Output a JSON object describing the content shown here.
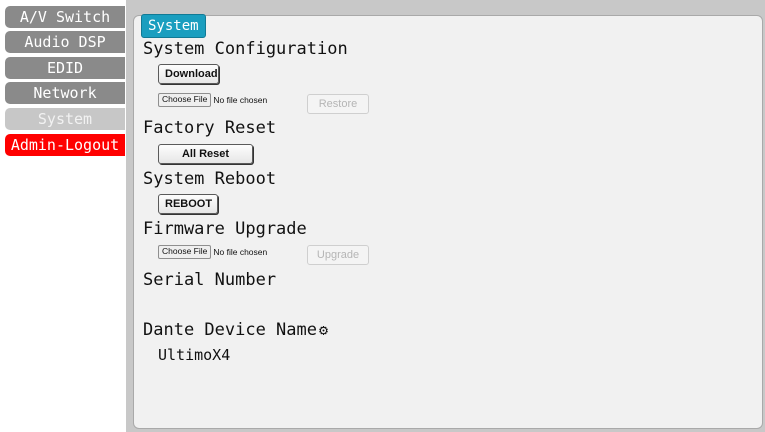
{
  "sidebar": {
    "items": [
      {
        "label": "A/V Switch"
      },
      {
        "label": "Audio DSP"
      },
      {
        "label": "EDID"
      },
      {
        "label": "Network"
      },
      {
        "label": "System",
        "active": true
      },
      {
        "label": "Admin-Logout"
      }
    ]
  },
  "main": {
    "tab": "System",
    "system_configuration": {
      "heading": "System Configuration",
      "download_label": "Download",
      "choose_file_label": "Choose File",
      "no_file_text": "No file chosen",
      "restore_label": "Restore"
    },
    "factory_reset": {
      "heading": "Factory Reset",
      "all_reset_label": "All Reset"
    },
    "system_reboot": {
      "heading": "System Reboot",
      "reboot_label": "REBOOT"
    },
    "firmware_upgrade": {
      "heading": "Firmware Upgrade",
      "choose_file_label": "Choose File",
      "no_file_text": "No file chosen",
      "upgrade_label": "Upgrade"
    },
    "serial_number": {
      "heading": "Serial Number"
    },
    "dante": {
      "heading": "Dante Device Name",
      "icon": "gear-icon",
      "value": "UltimoX4"
    }
  },
  "colors": {
    "tab": "#1a9ebf",
    "nav": "#8a8a8a",
    "nav_active": "#c7c7c7",
    "logout": "#ff0000"
  }
}
